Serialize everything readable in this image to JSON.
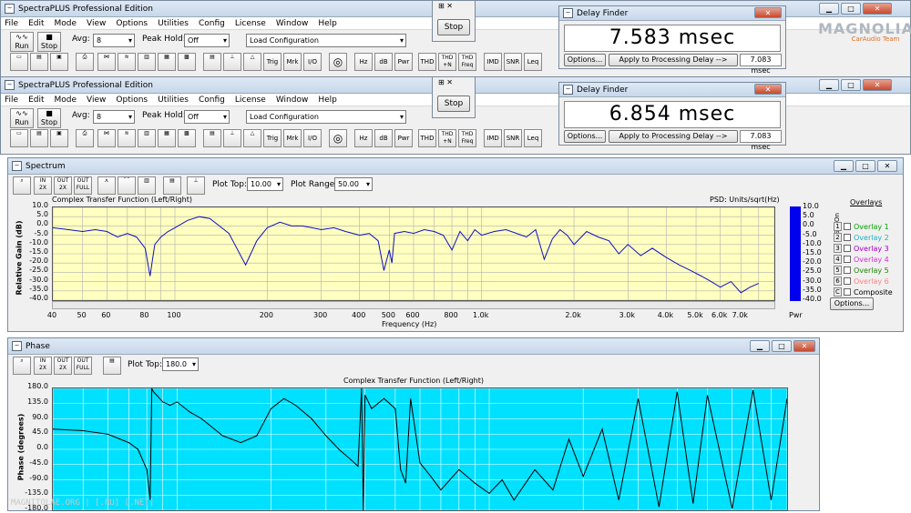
{
  "app": {
    "title": "SpectraPLUS Professional Edition",
    "menu": [
      "File",
      "Edit",
      "Mode",
      "View",
      "Options",
      "Utilities",
      "Config",
      "License",
      "Window",
      "Help"
    ],
    "run_label": "Run",
    "stop_label": "Stop",
    "avg_label": "Avg:",
    "avg_value": "8",
    "peak_hold_label": "Peak Hold:",
    "peak_hold_value": "Off",
    "load_config": "Load Configuration",
    "tool_labels": [
      "Trig",
      "Mrk",
      "I/O",
      "Hz",
      "dB",
      "Pwr",
      "THD",
      "IMD",
      "SNR",
      "Leq"
    ],
    "thd_n": "THD +N",
    "thd_freq": "THD Freq"
  },
  "stop_popup": {
    "label": "Stop"
  },
  "delay_finder_1": {
    "title": "Delay Finder",
    "value": "7.583 msec",
    "options": "Options...",
    "apply": "Apply to Processing Delay -->",
    "delay": "7.083 msec"
  },
  "delay_finder_2": {
    "title": "Delay Finder",
    "value": "6.854 msec",
    "options": "Options...",
    "apply": "Apply to Processing Delay -->",
    "delay": "7.083 msec"
  },
  "logo": {
    "text": "MAGNOLIA",
    "sub": "CarAudio Team"
  },
  "spectrum": {
    "title": "Spectrum",
    "plot_top_label": "Plot Top:",
    "plot_top": "10.00",
    "plot_range_label": "Plot Range:",
    "plot_range": "50.00",
    "chart_title": "Complex Transfer Function (Left/Right)",
    "psd": "PSD: Units/sqrt(Hz)",
    "ylabel": "Relative Gain (dB)",
    "xlabel": "Frequency (Hz)",
    "pwr": "Pwr",
    "overlays_title": "Overlays",
    "set_on": "Set On",
    "overlays": [
      {
        "num": "1",
        "name": "Overlay 1",
        "color": "#00a000"
      },
      {
        "num": "2",
        "name": "Overlay 2",
        "color": "#20b0c0"
      },
      {
        "num": "3",
        "name": "Overlay 3",
        "color": "#a000c0"
      },
      {
        "num": "4",
        "name": "Overlay 4",
        "color": "#d030d0"
      },
      {
        "num": "5",
        "name": "Overlay 5",
        "color": "#208000"
      },
      {
        "num": "6",
        "name": "Overlay 6",
        "color": "#ff8080"
      },
      {
        "num": "C",
        "name": "Composite",
        "color": "#000000"
      }
    ],
    "options": "Options..."
  },
  "phase": {
    "title": "Phase",
    "plot_top_label": "Plot Top:",
    "plot_top": "180.0",
    "chart_title": "Complex Transfer Function (Left/Right)",
    "ylabel": "Phase (degrees)"
  },
  "watermark": "MAGNITOLAE.ORG | [.RU] [.NET]",
  "chart_data": [
    {
      "type": "line",
      "title": "Complex Transfer Function (Left/Right)",
      "xlabel": "Frequency (Hz)",
      "ylabel": "Relative Gain (dB)",
      "xscale": "log",
      "xlim": [
        40,
        9000
      ],
      "ylim": [
        -40,
        10
      ],
      "yticks": [
        "10.0",
        "5.0",
        "0.0",
        "-5.0",
        "-10.0",
        "-15.0",
        "-20.0",
        "-25.0",
        "-30.0",
        "-35.0",
        "-40.0"
      ],
      "xticks": [
        "40",
        "50",
        "60",
        "80",
        "100",
        "200",
        "300",
        "400",
        "500",
        "600",
        "800",
        "1.0k",
        "2.0k",
        "3.0k",
        "4.0k",
        "5.0k",
        "6.0k",
        "7.0k"
      ],
      "colorbar_ticks": [
        "10.0",
        "5.0",
        "0.0",
        "-5.0",
        "-10.0",
        "-15.0",
        "-20.0",
        "-25.0",
        "-30.0",
        "-35.0",
        "-40.0"
      ],
      "series": [
        {
          "color": "#1010c0",
          "x": [
            40,
            45,
            50,
            55,
            60,
            65,
            70,
            75,
            80,
            83,
            86,
            90,
            95,
            100,
            110,
            120,
            130,
            150,
            170,
            185,
            200,
            220,
            240,
            260,
            280,
            300,
            330,
            360,
            400,
            430,
            460,
            480,
            500,
            510,
            520,
            560,
            600,
            650,
            700,
            750,
            800,
            850,
            900,
            950,
            1000,
            1100,
            1200,
            1300,
            1400,
            1500,
            1600,
            1700,
            1800,
            1900,
            2000,
            2200,
            2400,
            2600,
            2800,
            3000,
            3300,
            3600,
            4000,
            4400,
            4800,
            5200,
            5600,
            6000,
            6500,
            7000,
            7500,
            8000
          ],
          "y": [
            -1,
            -2,
            -3,
            -2,
            -3,
            -6,
            -4,
            -6,
            -12,
            -27,
            -10,
            -6,
            -3,
            -1,
            3,
            5,
            4,
            -4,
            -21,
            -8,
            -1,
            2,
            0,
            0,
            -1,
            -2,
            -1,
            -3,
            -5,
            -4,
            -8,
            -24,
            -13,
            -20,
            -4,
            -3,
            -4,
            -2,
            -3,
            -5,
            -13,
            -3,
            -8,
            -2,
            -5,
            -3,
            -2,
            -4,
            -6,
            -2,
            -18,
            -7,
            -2,
            -5,
            -10,
            -3,
            -6,
            -8,
            -15,
            -10,
            -16,
            -12,
            -17,
            -21,
            -24,
            -27,
            -30,
            -33,
            -30,
            -36,
            -33,
            -31
          ]
        }
      ]
    },
    {
      "type": "line",
      "title": "Complex Transfer Function (Left/Right)",
      "ylabel": "Phase (degrees)",
      "xscale": "log",
      "xlim": [
        40,
        9000
      ],
      "ylim": [
        -180,
        180
      ],
      "yticks": [
        "180.0",
        "135.0",
        "90.0",
        "45.0",
        "0.0",
        "-45.0",
        "-90.0",
        "-135.0",
        "-180.0"
      ],
      "series": [
        {
          "color": "#000000",
          "x": [
            40,
            50,
            60,
            70,
            75,
            80,
            82,
            83,
            84,
            86,
            90,
            95,
            100,
            110,
            120,
            140,
            160,
            180,
            200,
            220,
            240,
            270,
            300,
            330,
            360,
            380,
            390,
            395,
            400,
            420,
            460,
            500,
            520,
            540,
            560,
            600,
            650,
            700,
            800,
            900,
            1000,
            1100,
            1200,
            1400,
            1600,
            1800,
            2000,
            2300,
            2600,
            3000,
            3500,
            4000,
            4500,
            5000,
            6000,
            7000,
            8000,
            9000
          ],
          "y": [
            60,
            55,
            45,
            20,
            0,
            -60,
            -150,
            180,
            170,
            160,
            140,
            130,
            140,
            110,
            90,
            40,
            20,
            40,
            120,
            150,
            130,
            90,
            40,
            0,
            -30,
            -50,
            180,
            -180,
            160,
            120,
            150,
            120,
            -60,
            -100,
            150,
            -40,
            -80,
            -120,
            -60,
            -100,
            -130,
            -90,
            -150,
            -60,
            -120,
            30,
            -80,
            60,
            -150,
            150,
            -170,
            170,
            -160,
            160,
            -175,
            175,
            -150,
            150
          ]
        }
      ]
    }
  ]
}
